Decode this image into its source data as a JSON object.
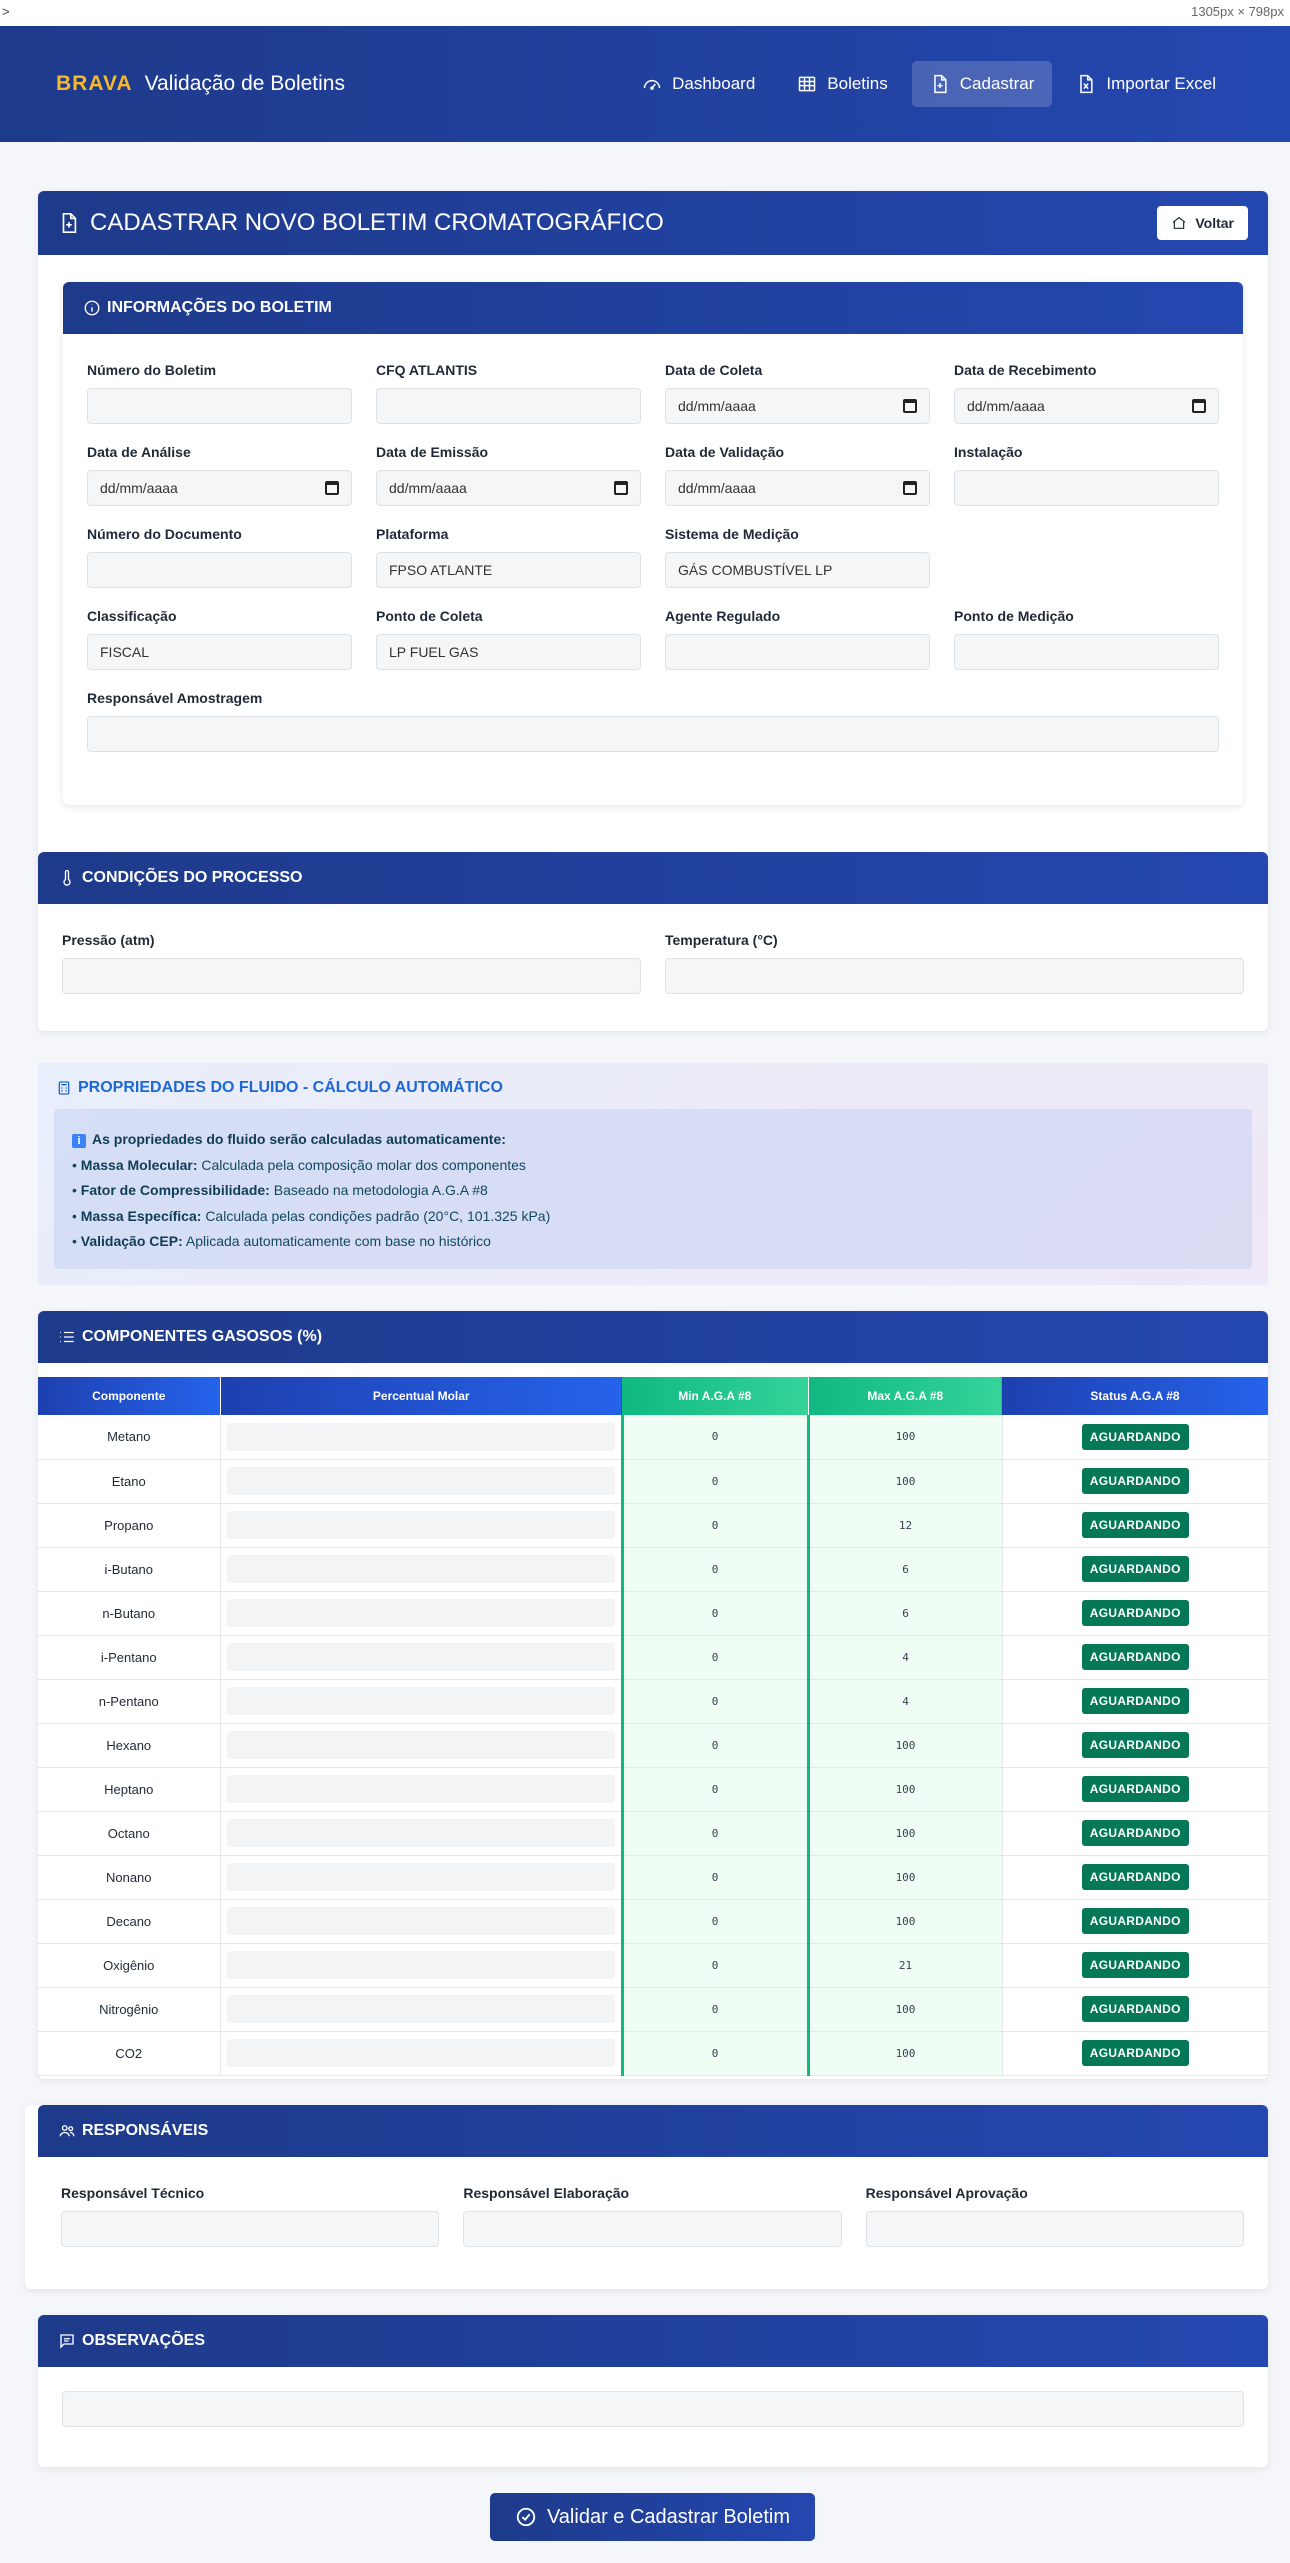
{
  "browser": {
    "left_text": ">",
    "size_text": "1305px × 798px"
  },
  "brand": {
    "name": "BRAVA",
    "title": "Validação de Boletins"
  },
  "nav": [
    {
      "label": "Dashboard",
      "icon": "gauge-icon"
    },
    {
      "label": "Boletins",
      "icon": "table-icon"
    },
    {
      "label": "Cadastrar",
      "icon": "file-plus-icon",
      "active": true
    },
    {
      "label": "Importar Excel",
      "icon": "file-excel-icon"
    }
  ],
  "main": {
    "title": "CADASTRAR NOVO BOLETIM CROMATOGRÁFICO",
    "back_label": "Voltar"
  },
  "info": {
    "title": "INFORMAÇÕES DO BOLETIM",
    "fields": {
      "numero_boletim": {
        "label": "Número do Boletim",
        "value": ""
      },
      "cfq": {
        "label": "CFQ ATLANTIS",
        "value": ""
      },
      "data_coleta": {
        "label": "Data de Coleta",
        "value": "dd/mm/aaaa"
      },
      "data_recebimento": {
        "label": "Data de Recebimento",
        "value": "dd/mm/aaaa"
      },
      "data_analise": {
        "label": "Data de Análise",
        "value": "dd/mm/aaaa"
      },
      "data_emissao": {
        "label": "Data de Emissão",
        "value": "dd/mm/aaaa"
      },
      "data_validacao": {
        "label": "Data de Validação",
        "value": "dd/mm/aaaa"
      },
      "instalacao": {
        "label": "Instalação",
        "value": ""
      },
      "numero_documento": {
        "label": "Número do Documento",
        "value": ""
      },
      "plataforma": {
        "label": "Plataforma",
        "value": "FPSO ATLANTE"
      },
      "sistema_medicao": {
        "label": "Sistema de Medição",
        "value": "GÁS COMBUSTÍVEL LP"
      },
      "classificacao": {
        "label": "Classificação",
        "value": "FISCAL"
      },
      "ponto_coleta": {
        "label": "Ponto de Coleta",
        "value": "LP FUEL GAS"
      },
      "agente_regulado": {
        "label": "Agente Regulado",
        "value": ""
      },
      "ponto_medicao": {
        "label": "Ponto de Medição",
        "value": ""
      },
      "responsavel_amostragem": {
        "label": "Responsável Amostragem",
        "value": ""
      }
    }
  },
  "processo": {
    "title": "CONDIÇÕES DO PROCESSO",
    "pressao": {
      "label": "Pressão (atm)",
      "value": ""
    },
    "temperatura": {
      "label": "Temperatura (°C)",
      "value": ""
    }
  },
  "propriedades": {
    "title": "PROPRIEDADES DO FLUIDO - CÁLCULO AUTOMÁTICO",
    "intro": "As propriedades do fluido serão calculadas automaticamente:",
    "items": [
      {
        "key": "Massa Molecular:",
        "text": "Calculada pela composição molar dos componentes"
      },
      {
        "key": "Fator de Compressibilidade:",
        "text": "Baseado na metodologia A.G.A #8"
      },
      {
        "key": "Massa Específica:",
        "text": "Calculada pelas condições padrão (20°C, 101.325 kPa)"
      },
      {
        "key": "Validação CEP:",
        "text": "Aplicada automaticamente com base no histórico"
      }
    ]
  },
  "componentes": {
    "title": "COMPONENTES GASOSOS (%)",
    "headers": [
      "Componente",
      "Percentual Molar",
      "Min A.G.A #8",
      "Max A.G.A #8",
      "Status A.G.A #8"
    ],
    "rows": [
      {
        "name": "Metano",
        "min": "0",
        "max": "100",
        "status": "AGUARDANDO"
      },
      {
        "name": "Etano",
        "min": "0",
        "max": "100",
        "status": "AGUARDANDO"
      },
      {
        "name": "Propano",
        "min": "0",
        "max": "12",
        "status": "AGUARDANDO"
      },
      {
        "name": "i-Butano",
        "min": "0",
        "max": "6",
        "status": "AGUARDANDO"
      },
      {
        "name": "n-Butano",
        "min": "0",
        "max": "6",
        "status": "AGUARDANDO"
      },
      {
        "name": "i-Pentano",
        "min": "0",
        "max": "4",
        "status": "AGUARDANDO"
      },
      {
        "name": "n-Pentano",
        "min": "0",
        "max": "4",
        "status": "AGUARDANDO"
      },
      {
        "name": "Hexano",
        "min": "0",
        "max": "100",
        "status": "AGUARDANDO"
      },
      {
        "name": "Heptano",
        "min": "0",
        "max": "100",
        "status": "AGUARDANDO"
      },
      {
        "name": "Octano",
        "min": "0",
        "max": "100",
        "status": "AGUARDANDO"
      },
      {
        "name": "Nonano",
        "min": "0",
        "max": "100",
        "status": "AGUARDANDO"
      },
      {
        "name": "Decano",
        "min": "0",
        "max": "100",
        "status": "AGUARDANDO"
      },
      {
        "name": "Oxigênio",
        "min": "0",
        "max": "21",
        "status": "AGUARDANDO"
      },
      {
        "name": "Nitrogênio",
        "min": "0",
        "max": "100",
        "status": "AGUARDANDO"
      },
      {
        "name": "CO2",
        "min": "0",
        "max": "100",
        "status": "AGUARDANDO"
      }
    ]
  },
  "responsaveis": {
    "title": "RESPONSÁVEIS",
    "tecnico": {
      "label": "Responsável Técnico",
      "value": ""
    },
    "elaboracao": {
      "label": "Responsável Elaboração",
      "value": ""
    },
    "aprovacao": {
      "label": "Responsável Aprovação",
      "value": ""
    }
  },
  "observacoes": {
    "title": "OBSERVAÇÕES",
    "value": ""
  },
  "submit": {
    "label": "Validar e Cadastrar Boletim"
  },
  "colors": {
    "primary": "#1e3a8a",
    "accent": "#f5b82e",
    "success": "#047857",
    "aga_green": "#10b981"
  }
}
